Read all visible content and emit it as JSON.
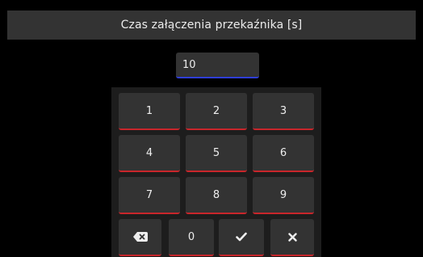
{
  "dialog": {
    "title": "Czas załączenia przekaźnika [s]",
    "value": "10"
  },
  "keypad": {
    "digits": [
      "1",
      "2",
      "3",
      "4",
      "5",
      "6",
      "7",
      "8",
      "9"
    ],
    "zero": "0",
    "backspace_icon": "backspace-icon",
    "confirm_icon": "check-icon",
    "cancel_icon": "close-icon"
  },
  "colors": {
    "background": "#000000",
    "panel": "#333333",
    "keypad_bg": "#1d1d1d",
    "input_accent": "#2f3ed6",
    "key_accent": "#c8262b",
    "text": "#ececec"
  }
}
